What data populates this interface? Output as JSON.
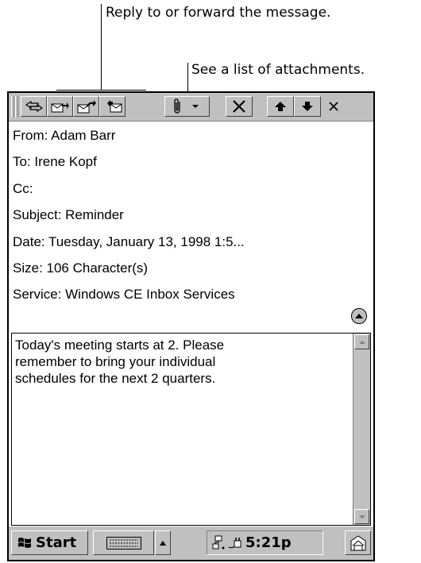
{
  "callouts": {
    "reply_forward": "Reply to or forward the message.",
    "attachments": "See a list of attachments."
  },
  "toolbar": {
    "icons": [
      "reply-icon",
      "reply-all-icon",
      "forward-icon",
      "compose-icon",
      "attachment-icon",
      "dropdown-arrow-icon",
      "delete-icon",
      "previous-message-icon",
      "next-message-icon",
      "close-icon"
    ]
  },
  "message": {
    "from": "From:  Adam Barr",
    "to": "To:  Irene Kopf",
    "cc": "Cc:",
    "subject": "Subject:  Reminder",
    "date": "Date: Tuesday, January 13, 1998 1:5...",
    "size": "Size: 106 Character(s)",
    "service": "Service: Windows CE Inbox Services",
    "body": "Today's meeting starts at 2. Please\nremember to bring your individual\nschedules for the next 2 quarters."
  },
  "taskbar": {
    "start_label": "Start",
    "clock": "5:21p",
    "icons": [
      "windows-flag-icon",
      "keyboard-icon",
      "input-panel-arrow-icon",
      "network-icon",
      "power-plug-icon",
      "desktop-switch-icon"
    ]
  },
  "colors": {
    "face": "#c0c0c0",
    "highlight": "#ffffff",
    "shadow": "#808080",
    "text": "#000000"
  }
}
